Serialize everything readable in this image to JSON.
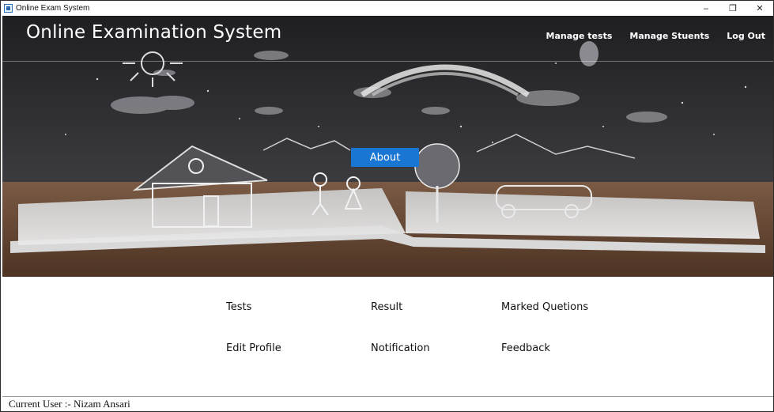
{
  "window": {
    "title": "Online Exam System",
    "controls": {
      "minimize": "‒",
      "restore": "❐",
      "close": "✕"
    }
  },
  "header": {
    "site_title": "Online Examination System",
    "nav": [
      {
        "label": "Manage tests"
      },
      {
        "label": "Manage Stuents"
      },
      {
        "label": "Log Out"
      }
    ],
    "about_label": "About"
  },
  "menu": {
    "items": [
      {
        "label": "Tests"
      },
      {
        "label": "Result"
      },
      {
        "label": "Marked Quetions"
      },
      {
        "label": "Edit Profile"
      },
      {
        "label": "Notification"
      },
      {
        "label": "Feedback"
      }
    ]
  },
  "status": {
    "current_user": "Current User :- Nizam Ansari"
  },
  "colors": {
    "accent": "#1976d2",
    "hero_bg": "#2f2f32",
    "table_wood": "#6b4a34"
  }
}
